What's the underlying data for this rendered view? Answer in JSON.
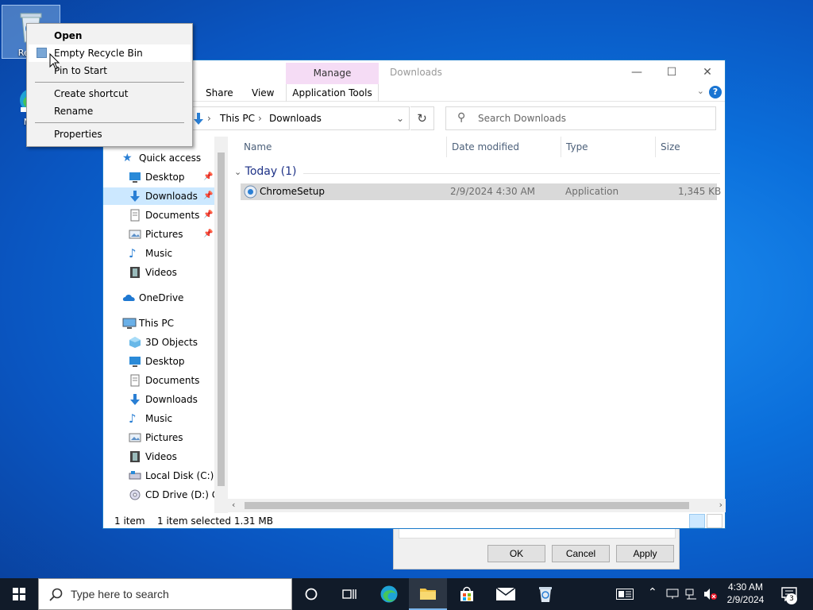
{
  "desktop": {
    "recycle_label": "Recyc",
    "edge_label_1": "Mic",
    "edge_label_2": "E"
  },
  "context_menu": {
    "items": [
      "Open",
      "Empty Recycle Bin",
      "Pin to Start",
      "Create shortcut",
      "Rename",
      "Properties"
    ]
  },
  "explorer": {
    "title": "Downloads",
    "manage_tab": "Manage",
    "ribbon_tabs": [
      "Share",
      "View"
    ],
    "application_tools": "Application Tools",
    "breadcrumb": [
      "This PC",
      "Downloads"
    ],
    "search_placeholder": "Search Downloads",
    "nav": {
      "quick_access": "Quick access",
      "quick_items": [
        "Desktop",
        "Downloads",
        "Documents",
        "Pictures",
        "Music",
        "Videos"
      ],
      "onedrive": "OneDrive",
      "this_pc": "This PC",
      "pc_items": [
        "3D Objects",
        "Desktop",
        "Documents",
        "Downloads",
        "Music",
        "Pictures",
        "Videos",
        "Local Disk (C:)",
        "CD Drive (D:) GS"
      ]
    },
    "columns": [
      "Name",
      "Date modified",
      "Type",
      "Size"
    ],
    "group": "Today (1)",
    "files": [
      {
        "name": "ChromeSetup",
        "date": "2/9/2024 4:30 AM",
        "type": "Application",
        "size": "1,345 KB"
      }
    ],
    "status": {
      "count": "1 item",
      "selected": "1 item selected  1.31 MB"
    }
  },
  "properties_dialog": {
    "ok": "OK",
    "cancel": "Cancel",
    "apply": "Apply"
  },
  "taskbar": {
    "search_placeholder": "Type here to search",
    "time": "4:30 AM",
    "date": "2/9/2024",
    "notifications": "3"
  }
}
